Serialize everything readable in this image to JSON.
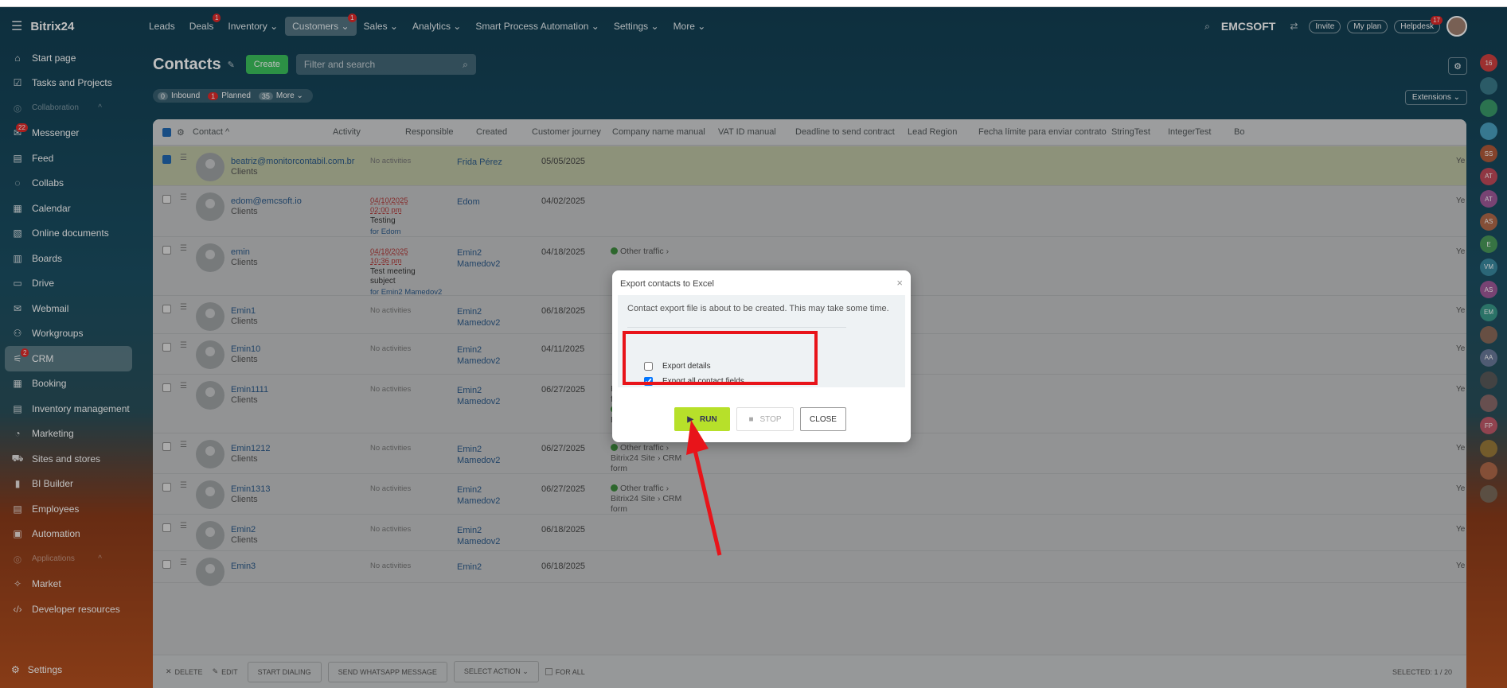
{
  "app": {
    "logo": "Bitrix24"
  },
  "topmenu": [
    {
      "label": "Leads"
    },
    {
      "label": "Deals",
      "badge": "1"
    },
    {
      "label": "Inventory ⌄"
    },
    {
      "label": "Customers ⌄",
      "badge": "1",
      "active": true
    },
    {
      "label": "Sales ⌄"
    },
    {
      "label": "Analytics ⌄"
    },
    {
      "label": "Smart Process Automation ⌄"
    },
    {
      "label": "Settings ⌄"
    },
    {
      "label": "More ⌄"
    }
  ],
  "topright": {
    "company": "EMCSOFT",
    "invite": "Invite",
    "myplan": "My plan",
    "helpdesk": "Helpdesk",
    "helpdesk_badge": "17"
  },
  "sidebar": {
    "items": [
      {
        "label": "Start page",
        "icon": "⌂"
      },
      {
        "label": "Tasks and Projects",
        "icon": "☑"
      },
      {
        "label": "Collaboration",
        "icon": "◎",
        "section": true
      },
      {
        "label": "Messenger",
        "icon": "✉",
        "badge": "22"
      },
      {
        "label": "Feed",
        "icon": "▤"
      },
      {
        "label": "Collabs",
        "icon": "◌"
      },
      {
        "label": "Calendar",
        "icon": "▦"
      },
      {
        "label": "Online documents",
        "icon": "▧"
      },
      {
        "label": "Boards",
        "icon": "▥"
      },
      {
        "label": "Drive",
        "icon": "▭"
      },
      {
        "label": "Webmail",
        "icon": "✉"
      },
      {
        "label": "Workgroups",
        "icon": "⚇"
      },
      {
        "label": "CRM",
        "icon": "⚟",
        "active": true,
        "badge": "2"
      },
      {
        "label": "Booking",
        "icon": "▦"
      },
      {
        "label": "Inventory management",
        "icon": "▤"
      },
      {
        "label": "Marketing",
        "icon": "◔"
      },
      {
        "label": "Sites and stores",
        "icon": "⛟"
      },
      {
        "label": "BI Builder",
        "icon": "▮"
      },
      {
        "label": "Employees",
        "icon": "▤"
      },
      {
        "label": "Automation",
        "icon": "▣"
      },
      {
        "label": "Applications",
        "icon": "◎",
        "section": true
      },
      {
        "label": "Market",
        "icon": "✧"
      },
      {
        "label": "Developer resources",
        "icon": "‹/›"
      }
    ],
    "settings": "Settings"
  },
  "page": {
    "title": "Contacts",
    "create": "Create",
    "search_placeholder": "Filter and search",
    "counters": [
      {
        "num": "0",
        "label": "Inbound"
      },
      {
        "num": "1",
        "label": "Planned",
        "red": true
      },
      {
        "num": "35",
        "label": "More ⌄"
      }
    ],
    "extensions": "Extensions ⌄"
  },
  "grid": {
    "headers": [
      "Contact ^",
      "Activity",
      "Responsible",
      "Created",
      "Customer journey",
      "Company name manual",
      "VAT ID manual",
      "Deadline to send contract",
      "Lead Region",
      "Fecha límite para enviar contrato",
      "StringTest",
      "IntegerTest",
      "Bo"
    ],
    "rows": [
      {
        "name": "beatriz@monitorcontabil.com.br",
        "type": "Clients",
        "activity": "No activities",
        "resp": "Frida Pérez",
        "created": "05/05/2025",
        "sel": true
      },
      {
        "name": "edom@emcsoft.io",
        "type": "Clients",
        "activity_date": "04/10/2025",
        "activity_time": "02:00 pm",
        "activity_subj": "Testing",
        "activity_for": "for  Edom",
        "resp": "Edom",
        "created": "04/02/2025"
      },
      {
        "name": "emin",
        "type": "Clients",
        "activity_date": "04/18/2025",
        "activity_time": "10:36 pm",
        "activity_subj": "Test meeting",
        "activity_subj2": "subject",
        "activity_for": "for  Emin2 Mamedov2",
        "resp": "Emin2",
        "resp2": "Mamedov2",
        "created": "04/18/2025",
        "journey": "Other traffic ›"
      },
      {
        "name": "Emin1",
        "type": "Clients",
        "activity": "No activities",
        "resp": "Emin2",
        "resp2": "Mamedov2",
        "created": "06/18/2025"
      },
      {
        "name": "Emin10",
        "type": "Clients",
        "activity": "No activities",
        "resp": "Emin2",
        "resp2": "Mamedov2",
        "created": "04/11/2025"
      },
      {
        "name": "Emin1111",
        "type": "Clients",
        "activity": "No activities",
        "resp": "Emin2",
        "resp2": "Mamedov2",
        "created": "06/27/2025",
        "journey_a": "Bitrix24 Site › CRM",
        "journey_b": "form",
        "journey_c": "Other traffic ›",
        "journey_d": "Bitrix24 Site"
      },
      {
        "name": "Emin1212",
        "type": "Clients",
        "activity": "No activities",
        "resp": "Emin2",
        "resp2": "Mamedov2",
        "created": "06/27/2025",
        "journey": "Other traffic ›",
        "journey_b": "Bitrix24 Site › CRM",
        "journey_c": "form"
      },
      {
        "name": "Emin1313",
        "type": "Clients",
        "activity": "No activities",
        "resp": "Emin2",
        "resp2": "Mamedov2",
        "created": "06/27/2025",
        "journey": "Other traffic ›",
        "journey_b": "Bitrix24 Site › CRM",
        "journey_c": "form"
      },
      {
        "name": "Emin2",
        "type": "Clients",
        "activity": "No activities",
        "resp": "Emin2",
        "resp2": "Mamedov2",
        "created": "06/18/2025"
      },
      {
        "name": "Emin3",
        "activity": "No activities",
        "resp": "Emin2",
        "created": "06/18/2025"
      }
    ],
    "ye": "Ye",
    "footer": {
      "delete": "DELETE",
      "edit": "EDIT",
      "start_dialing": "START DIALING",
      "whatsapp": "SEND WHATSAPP MESSAGE",
      "select_action": "SELECT ACTION",
      "for_all": "FOR ALL",
      "selected": "SELECTED: 1 / 20"
    }
  },
  "rail": [
    "16",
    "",
    "",
    "",
    "SS",
    "AT",
    "AT",
    "AS",
    "E",
    "VM",
    "AS",
    "EM",
    "",
    "AA",
    "",
    "",
    "FP",
    "",
    "",
    ""
  ],
  "dialog": {
    "title": "Export contacts to Excel",
    "message": "Contact export file is about to be created. This may take some time.",
    "opt1": "Export details",
    "opt1_checked": false,
    "opt2": "Export all contact fields",
    "opt2_checked": true,
    "run": "RUN",
    "stop": "STOP",
    "close": "CLOSE"
  },
  "colors": {
    "accent_green": "#3bc15c",
    "run_button": "#b7e02a",
    "highlight_red": "#e8141a",
    "link_blue": "#2c5a8a"
  }
}
